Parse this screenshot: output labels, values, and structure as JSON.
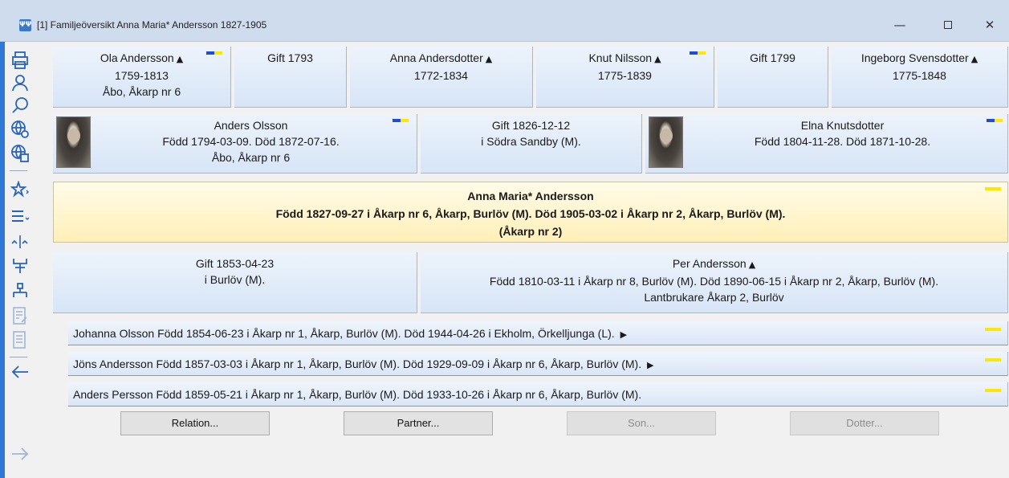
{
  "window": {
    "app_icon": "ΨΨ",
    "title": "[1] Familjeöversikt Anna Maria* Andersson 1827-1905",
    "min_glyph": "—",
    "close_glyph": "✕"
  },
  "toolbar": {
    "icons": [
      "print-icon",
      "person-icon",
      "search-icon",
      "globe-settings-icon",
      "globe-window-icon",
      "star-menu-icon",
      "list-menu-icon",
      "compare-icon",
      "family-tree-icon",
      "hierarchy-icon",
      "edit-note-icon",
      "document-list-icon",
      "back-arrow-icon",
      "forward-arrow-icon"
    ]
  },
  "grandparents": {
    "left_man": {
      "name": "Ola Andersson",
      "years": "1759-1813",
      "place": "Åbo, Åkarp nr 6"
    },
    "left_marriage": "Gift 1793",
    "left_woman": {
      "name": "Anna Andersdotter",
      "years": "1772-1834"
    },
    "right_man": {
      "name": "Knut Nilsson",
      "years": "1775-1839"
    },
    "right_marriage": "Gift 1799",
    "right_woman": {
      "name": "Ingeborg Svensdotter",
      "years": "1775-1848"
    },
    "triangle": "▲"
  },
  "parents": {
    "father": {
      "name": "Anders Olsson",
      "dates": "Född 1794-03-09. Död 1872-07-16.",
      "place": "Åbo, Åkarp nr 6"
    },
    "marriage": {
      "line1": "Gift 1826-12-12",
      "line2": "i Södra Sandby (M)."
    },
    "mother": {
      "name": "Elna Knutsdotter",
      "dates": "Född 1804-11-28. Död 1871-10-28."
    }
  },
  "focus": {
    "name": "Anna Maria* Andersson",
    "details": "Född 1827-09-27 i Åkarp nr 6, Åkarp, Burlöv (M). Död 1905-03-02 i Åkarp nr 2, Åkarp, Burlöv (M).",
    "place": "(Åkarp nr 2)"
  },
  "spouse": {
    "marriage": {
      "line1": "Gift 1853-04-23",
      "line2": "i Burlöv (M)."
    },
    "person": {
      "name": "Per Andersson",
      "details": "Född 1810-03-11 i Åkarp nr 8, Burlöv (M). Död 1890-06-15 i Åkarp nr 2, Åkarp, Burlöv (M).",
      "occupation": "Lantbrukare Åkarp 2, Burlöv"
    }
  },
  "children": [
    {
      "text": "Johanna Olsson Född 1854-06-23 i Åkarp nr 1, Åkarp, Burlöv (M). Död 1944-04-26 i Ekholm, Örkelljunga (L).",
      "arrow": "▶"
    },
    {
      "text": "Jöns Andersson Född 1857-03-03 i Åkarp nr 1, Åkarp, Burlöv (M). Död 1929-09-09 i Åkarp nr 6, Åkarp, Burlöv (M).",
      "arrow": "▶"
    },
    {
      "text": "Anders Persson Född 1859-05-21 i Åkarp nr 1, Åkarp, Burlöv (M). Död 1933-10-26 i Åkarp nr 6, Åkarp, Burlöv (M).",
      "arrow": ""
    }
  ],
  "buttons": {
    "relation": "Relation...",
    "partner": "Partner...",
    "son": "Son...",
    "daughter": "Dotter..."
  },
  "colors": {
    "accent": "#2f78d6",
    "focus_bg": "#fff4cc",
    "box_bg": "#dce8f7"
  }
}
